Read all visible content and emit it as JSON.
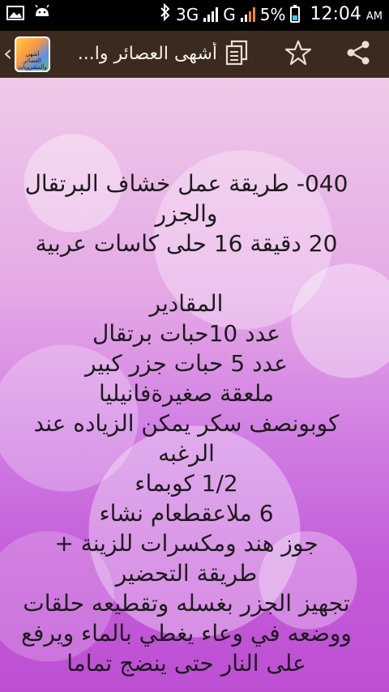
{
  "status_bar": {
    "network": "3G",
    "network2": "G",
    "battery": "5%",
    "time": "12:04",
    "ampm": "AM"
  },
  "action_bar": {
    "title": "أشهى العصائر وا...",
    "app_icon_label": "أشهى العصائر والمشروبات"
  },
  "recipe": {
    "lines": [
      "040- طريقة عمل خشاف البرتقال",
      "والجزر",
      "20 دقيقة  16  حلى كاسات عربية",
      "",
      "المقادير",
      "عدد 10حبات برتقال",
      "عدد 5 حبات جزر كبير",
      "ملعقة صغيرةفانيليا",
      "كوبونصف سكر يمكن الزياده عند",
      "الرغبه",
      "1/2 كوبماء",
      "6 ملاعقطعام نشاء",
      "جوز هند ومكسرات للزينة +",
      "طريقة التحضير",
      "تجهيز الجزر بغسله وتقطيعه حلقات",
      "ووضعه في وعاء يغطي بالماء ويرفع",
      "على النار حتى ينضج تماما"
    ]
  }
}
